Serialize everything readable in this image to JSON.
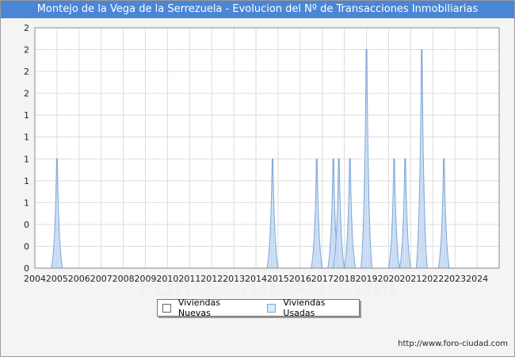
{
  "title": "Montejo de la Vega de la Serrezuela - Evolucion del Nº de Transacciones Inmobiliarias",
  "footer_url": "http://www.foro-ciudad.com",
  "watermark": "FORO-CIUDAD.COM",
  "colors": {
    "header": "#4a86d6",
    "plot_bg": "#ffffff",
    "grid": "#dddddd",
    "usadas_fill": "#dce9f8",
    "usadas_stroke": "#7ea6d9",
    "nuevas_fill": "#ffffff"
  },
  "chart_data": {
    "type": "area",
    "title": "Montejo de la Vega de la Serrezuela - Evolucion del Nº de Transacciones Inmobiliarias",
    "xlabel": "",
    "ylabel": "",
    "xlim": [
      2004,
      2025
    ],
    "ylim": [
      0,
      2.2
    ],
    "x_ticks": [
      "2004",
      "2005",
      "2006",
      "2007",
      "2008",
      "2009",
      "2010",
      "2011",
      "2012",
      "2013",
      "2014",
      "2015",
      "2016",
      "2017",
      "2018",
      "2019",
      "2020",
      "2021",
      "2022",
      "2023",
      "2024"
    ],
    "y_tick_labels": [
      "0",
      "0",
      "0",
      "1",
      "1",
      "1",
      "1",
      "1",
      "2",
      "2",
      "2",
      "2"
    ],
    "grid": true,
    "legend_position": "bottom-center",
    "series": [
      {
        "name": "Viviendas Nuevas",
        "points": []
      },
      {
        "name": "Viviendas Usadas",
        "points": [
          {
            "x": 2005.0,
            "y": 1
          },
          {
            "x": 2014.75,
            "y": 1
          },
          {
            "x": 2016.75,
            "y": 1
          },
          {
            "x": 2017.5,
            "y": 1
          },
          {
            "x": 2017.75,
            "y": 1
          },
          {
            "x": 2018.25,
            "y": 1
          },
          {
            "x": 2019.0,
            "y": 2
          },
          {
            "x": 2020.25,
            "y": 1
          },
          {
            "x": 2020.75,
            "y": 1
          },
          {
            "x": 2021.5,
            "y": 2
          },
          {
            "x": 2022.5,
            "y": 1
          }
        ]
      }
    ]
  }
}
